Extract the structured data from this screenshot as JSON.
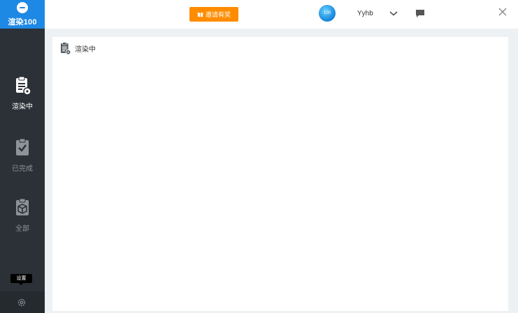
{
  "brand": {
    "name": "渲染100"
  },
  "sidebar": {
    "items": [
      {
        "label": "渲染中",
        "icon": "clipboard-gear-icon",
        "active": true
      },
      {
        "label": "已完成",
        "icon": "clipboard-check-icon",
        "active": false
      },
      {
        "label": "全部",
        "icon": "clipboard-box-icon",
        "active": false
      }
    ],
    "tooltip": "设置",
    "settings_icon": "gear-icon"
  },
  "topbar": {
    "invite_label": "邀请有奖",
    "avatar_text": "100",
    "username": "Yyhb"
  },
  "content": {
    "title": "渲染中"
  },
  "colors": {
    "accent": "#1e88e5",
    "invite": "#ff8c00",
    "sidebar_bg": "#2b3137",
    "panel_bg": "#eef1f3"
  }
}
